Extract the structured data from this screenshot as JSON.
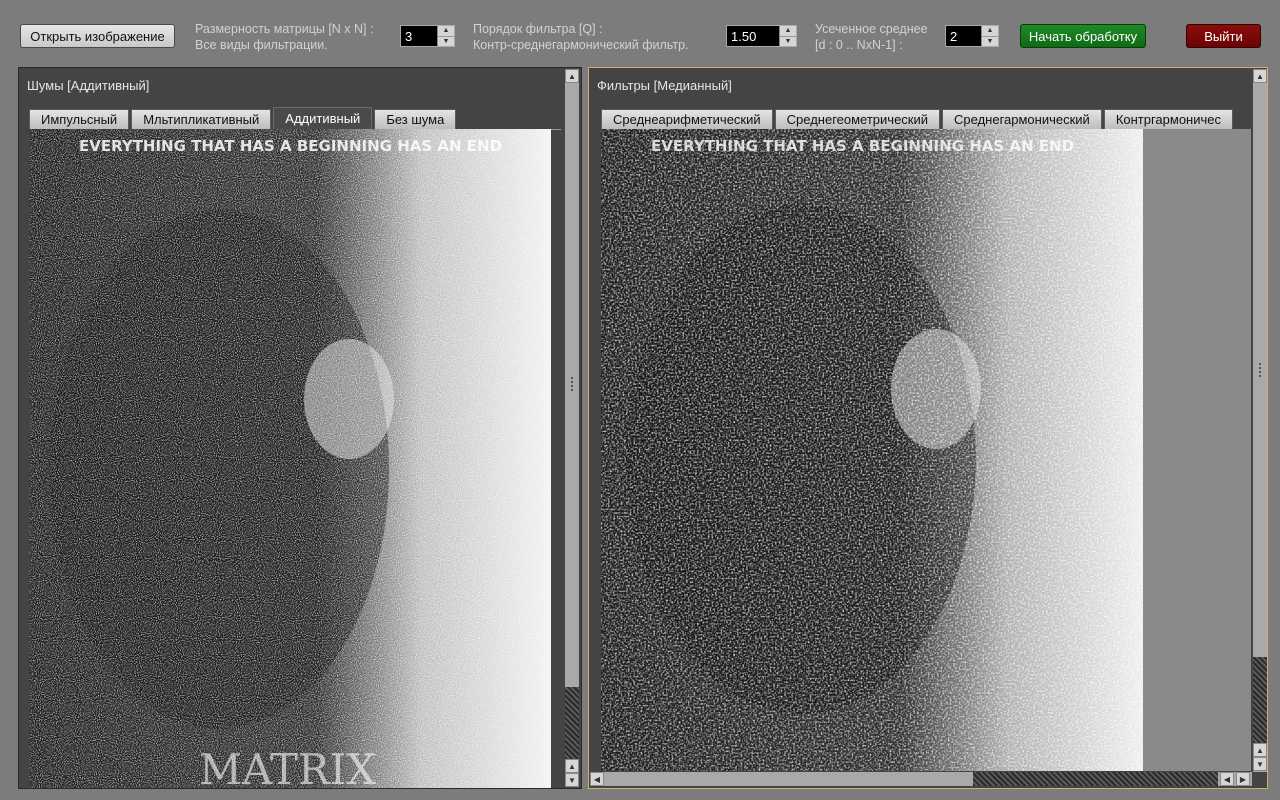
{
  "toolbar": {
    "open_button": "Открыть изображение",
    "matrix_label_1": "Размерность матрицы [N x N] :",
    "matrix_label_2": "Все виды фильтрации.",
    "matrix_value": "3",
    "order_label_1": "Порядок фильтра [Q] :",
    "order_label_2": "Контр-среднегармонический фильтр.",
    "order_value": "1.50",
    "trimmed_label_1": "Усеченное среднее",
    "trimmed_label_2": "[d : 0 .. NxN-1] :",
    "trimmed_value": "2",
    "start_button": "Начать обработку",
    "exit_button": "Выйти"
  },
  "noise_panel": {
    "title": "Шумы [Аддитивный]",
    "tabs": [
      {
        "label": "Импульсный",
        "active": false
      },
      {
        "label": "Мльтипликативный",
        "active": false
      },
      {
        "label": "Аддитивный",
        "active": true
      },
      {
        "label": "Без шума",
        "active": false
      }
    ],
    "image_caption": "EVERYTHING THAT HAS A BEGINNING HAS AN END",
    "image_logo": "MATRIX"
  },
  "filter_panel": {
    "title": "Фильтры [Медианный]",
    "tabs": [
      {
        "label": "Среднеарифметический",
        "active": false
      },
      {
        "label": "Среднегеометрический",
        "active": false
      },
      {
        "label": "Среднегармонический",
        "active": false
      },
      {
        "label": "Контргармоничес",
        "active": false
      }
    ],
    "image_caption": "EVERYTHING THAT HAS A BEGINNING HAS AN END"
  },
  "colors": {
    "start_button": "#157a1b",
    "exit_button": "#7a0606",
    "active_panel_border": "#cfb067"
  }
}
